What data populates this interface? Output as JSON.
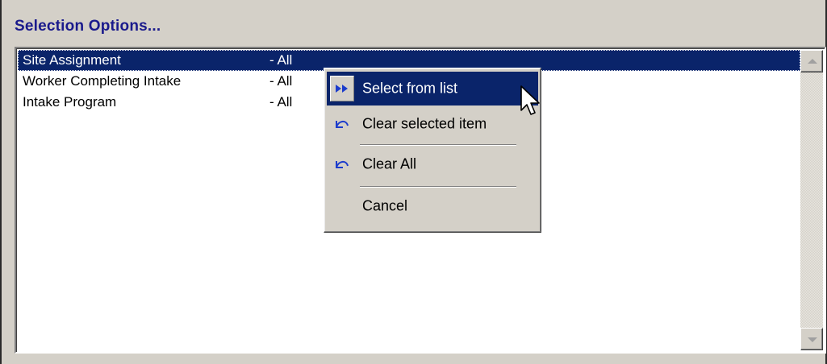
{
  "section": {
    "title": "Selection Options..."
  },
  "list": {
    "rows": [
      {
        "name": "Site Assignment",
        "value": "- All",
        "selected": true
      },
      {
        "name": "Worker Completing Intake",
        "value": "- All",
        "selected": false
      },
      {
        "name": "Intake Program",
        "value": "- All",
        "selected": false
      }
    ]
  },
  "context_menu": {
    "items": [
      {
        "label": "Select from list",
        "icon": "double-arrow-right-icon",
        "highlighted": true
      },
      {
        "label": "Clear selected item",
        "icon": "undo-arrow-icon",
        "highlighted": false
      },
      {
        "label": "Clear All",
        "icon": "undo-arrow-icon",
        "highlighted": false
      },
      {
        "label": "Cancel",
        "icon": "",
        "highlighted": false
      }
    ]
  },
  "colors": {
    "selection": "#0a246a",
    "title": "#1a1a8c",
    "window": "#d4d0c8",
    "icon_blue": "#1c3ccc"
  }
}
